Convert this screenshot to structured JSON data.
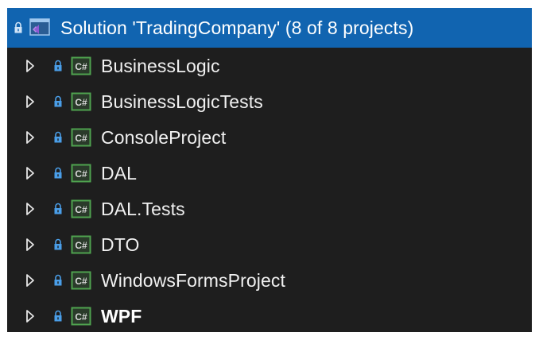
{
  "solution": {
    "label": "Solution 'TradingCompany' (8 of 8 projects)",
    "icon": "visual-studio-solution-icon",
    "selected": true
  },
  "projects": [
    {
      "label": "BusinessLogic",
      "icon": "csharp-project-icon",
      "bold": false
    },
    {
      "label": "BusinessLogicTests",
      "icon": "csharp-project-icon",
      "bold": false
    },
    {
      "label": "ConsoleProject",
      "icon": "csharp-project-icon",
      "bold": false
    },
    {
      "label": "DAL",
      "icon": "csharp-project-icon",
      "bold": false
    },
    {
      "label": "DAL.Tests",
      "icon": "csharp-project-icon",
      "bold": false
    },
    {
      "label": "DTO",
      "icon": "csharp-project-icon",
      "bold": false
    },
    {
      "label": "WindowsFormsProject",
      "icon": "csharp-project-icon",
      "bold": false
    },
    {
      "label": "WPF",
      "icon": "csharp-project-icon",
      "bold": true
    }
  ],
  "colors": {
    "background": "#1e1e1e",
    "selection": "#1164b0",
    "text": "#f1f1f1",
    "lock": "#4a9ee8",
    "csharp_border": "#4fa24f",
    "csharp_text": "#d8d8d8",
    "solution_purple": "#9b6dd6"
  }
}
